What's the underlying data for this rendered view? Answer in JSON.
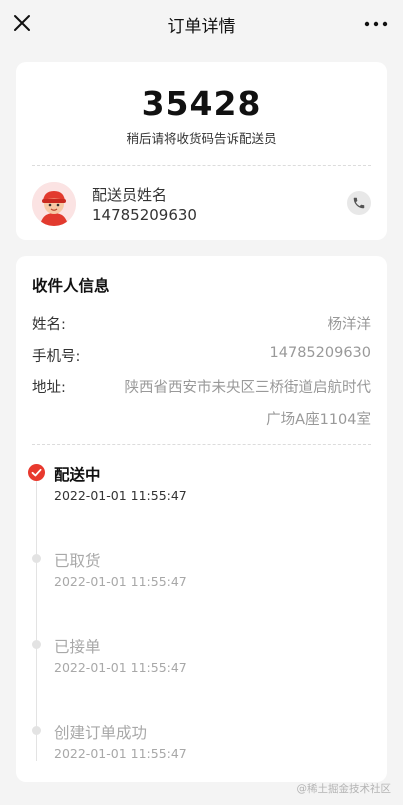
{
  "header": {
    "title": "订单详情",
    "close_icon": "close-icon",
    "more_icon": "more-icon"
  },
  "pickup": {
    "code": "35428",
    "hint": "稍后请将收货码告诉配送员"
  },
  "courier": {
    "name": "配送员姓名",
    "phone": "14785209630",
    "avatar_icon": "courier-avatar",
    "call_icon": "phone-icon"
  },
  "recipient": {
    "section_title": "收件人信息",
    "name_label": "姓名:",
    "name_value": "杨洋洋",
    "phone_label": "手机号:",
    "phone_value": "14785209630",
    "address_label": "地址:",
    "address_line1": "陕西省西安市未央区三桥街道启航时代",
    "address_line2": "广场A座1104室"
  },
  "timeline": [
    {
      "title": "配送中",
      "time": "2022-01-01 11:55:47",
      "active": true
    },
    {
      "title": "已取货",
      "time": "2022-01-01 11:55:47",
      "active": false
    },
    {
      "title": "已接单",
      "time": "2022-01-01 11:55:47",
      "active": false
    },
    {
      "title": "创建订单成功",
      "time": "2022-01-01 11:55:47",
      "active": false
    }
  ],
  "colors": {
    "accent": "#e8392e",
    "background": "#f4f4f4",
    "muted_text": "#999999"
  },
  "watermark": "@稀土掘金技术社区"
}
